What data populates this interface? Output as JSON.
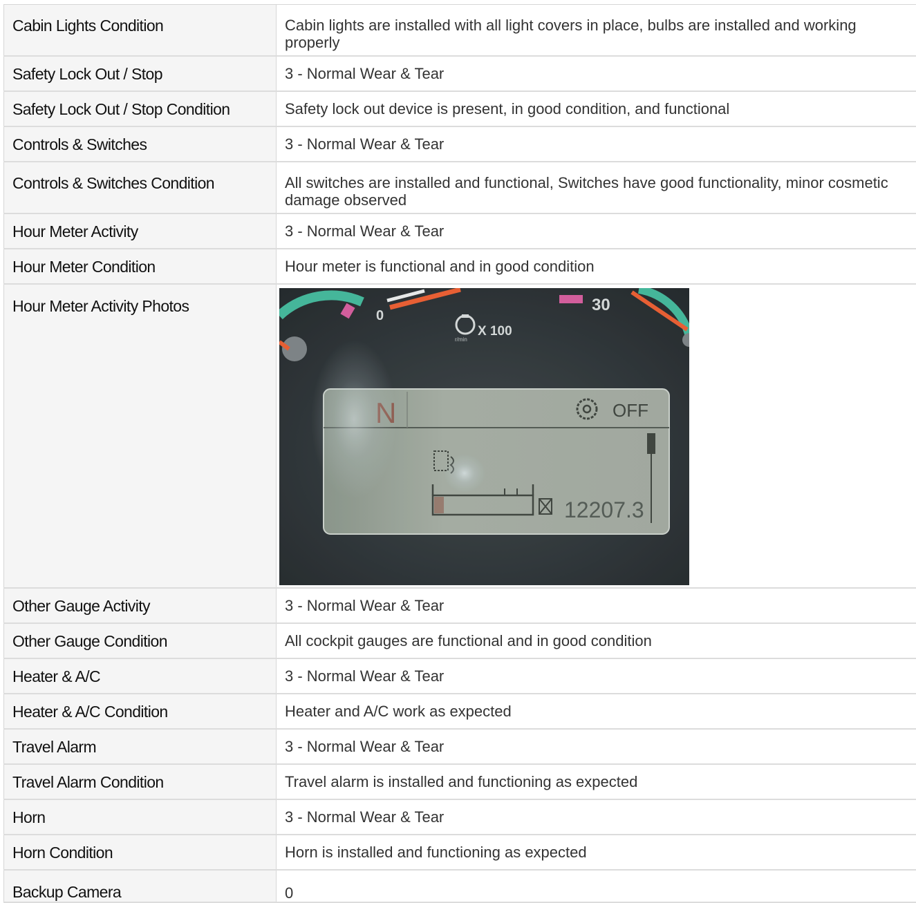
{
  "rows": [
    {
      "label": "Cabin Lights Condition",
      "value": "Cabin lights are installed with all light covers in place, bulbs are installed and working properly"
    },
    {
      "label": "Safety Lock Out / Stop",
      "value": "3 - Normal Wear & Tear"
    },
    {
      "label": "Safety Lock Out / Stop Condition",
      "value": "Safety lock out device is present, in good condition, and functional"
    },
    {
      "label": "Controls & Switches",
      "value": "3 - Normal Wear & Tear"
    },
    {
      "label": "Controls & Switches Condition",
      "value": "All switches are installed and functional, Switches have good functionality, minor cosmetic damage observed"
    },
    {
      "label": "Hour Meter Activity",
      "value": "3 - Normal Wear & Tear"
    },
    {
      "label": "Hour Meter Condition",
      "value": "Hour meter is functional and in good condition"
    },
    {
      "label": "Hour Meter Activity Photos",
      "photo": {
        "dial_low": "0",
        "dial_high": "30",
        "dial_unit": "X 100",
        "dial_unit_sub": "r/min",
        "gear": "N",
        "status": "OFF",
        "reading": "12207.3"
      }
    },
    {
      "label": "Other Gauge Activity",
      "value": "3 - Normal Wear & Tear"
    },
    {
      "label": "Other Gauge Condition",
      "value": "All cockpit gauges are functional and in good condition"
    },
    {
      "label": "Heater & A/C",
      "value": "3 - Normal Wear & Tear"
    },
    {
      "label": "Heater & A/C Condition",
      "value": "Heater and A/C work as expected"
    },
    {
      "label": "Travel Alarm",
      "value": "3 - Normal Wear & Tear"
    },
    {
      "label": "Travel Alarm Condition",
      "value": "Travel alarm is installed and functioning as expected"
    },
    {
      "label": "Horn",
      "value": "3 - Normal Wear & Tear"
    },
    {
      "label": "Horn Condition",
      "value": "Horn is installed and functioning as expected"
    },
    {
      "label": "Backup Camera",
      "value": "0"
    }
  ]
}
